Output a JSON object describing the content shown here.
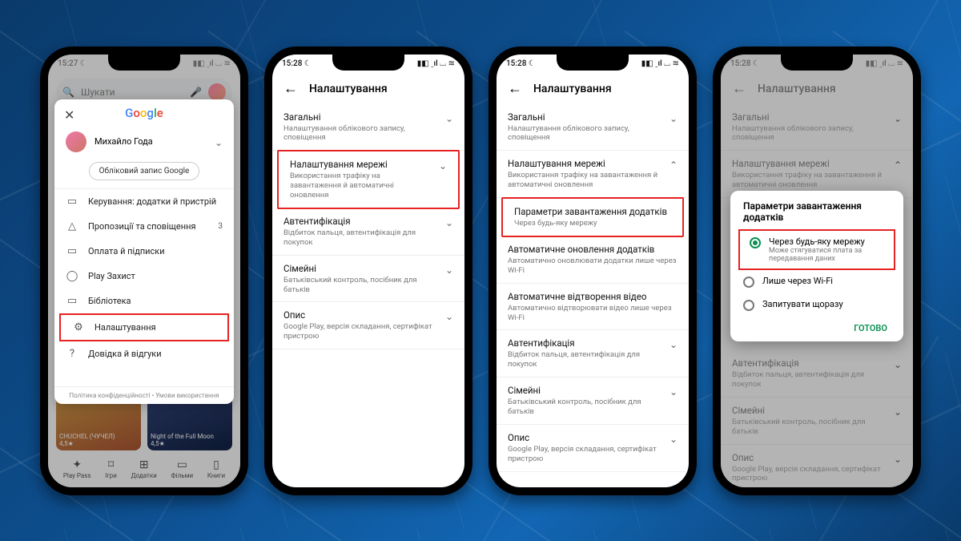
{
  "status": {
    "t1": "15:27",
    "t2": "15:28",
    "moon": "☾",
    "sig": "▮◧ ˍıl ⌴ ≋"
  },
  "p1": {
    "search_placeholder": "Шукати",
    "google": "Google",
    "user": "Михайло Года",
    "account_btn": "Обліковий запис Google",
    "menu": [
      {
        "icon": "▭",
        "label": "Керування: додатки й пристрій"
      },
      {
        "icon": "△",
        "label": "Пропозиції та сповіщення",
        "badge": "3"
      },
      {
        "icon": "▭",
        "label": "Оплата й підписки"
      },
      {
        "icon": "◯",
        "label": "Play Захист"
      },
      {
        "icon": "▭",
        "label": "Бібліотека"
      },
      {
        "icon": "⚙",
        "label": "Налаштування"
      },
      {
        "icon": "?",
        "label": "Довідка й відгуки"
      }
    ],
    "footer": "Політика конфіденційності  •  Умови використання",
    "tiles": [
      {
        "t": "CHUCHEL (ЧУЧЕЛ)",
        "r": "4,5★"
      },
      {
        "t": "Night of the Full Moon",
        "r": "4,5★"
      }
    ],
    "nav": [
      "Play Pass",
      "Ігри",
      "Додатки",
      "Фільми",
      "Книги"
    ],
    "nav_icons": [
      "✦",
      "⌑",
      "⊞",
      "▭",
      "▯"
    ]
  },
  "settings_title": "Налаштування",
  "sec": {
    "general": {
      "t": "Загальні",
      "s": "Налаштування облікового запису, сповіщення"
    },
    "network": {
      "t": "Налаштування мережі",
      "s": "Використання трафіку на завантаження й автоматичні оновлення"
    },
    "download": {
      "t": "Параметри завантаження додатків",
      "s": "Через будь-яку мережу"
    },
    "autoupd": {
      "t": "Автоматичне оновлення додатків",
      "s": "Автоматично оновлювати додатки лише через Wi-Fi"
    },
    "autoplay": {
      "t": "Автоматичне відтворення відео",
      "s": "Автоматично відтворювати відео лише через Wi-Fi"
    },
    "auth": {
      "t": "Автентифікація",
      "s": "Відбиток пальця, автентифікація для покупок"
    },
    "family": {
      "t": "Сімейні",
      "s": "Батьківський контроль, посібник для батьків"
    },
    "about": {
      "t": "Опис",
      "s": "Google Play, версія складання, сертифікат пристрою"
    }
  },
  "dlg": {
    "title": "Параметри завантаження додатків",
    "o1": {
      "t": "Через будь-яку мережу",
      "s": "Може стягуватися плата за передавання даних"
    },
    "o2": "Лише через Wi-Fi",
    "o3": "Запитувати щоразу",
    "done": "ГОТОВО"
  }
}
